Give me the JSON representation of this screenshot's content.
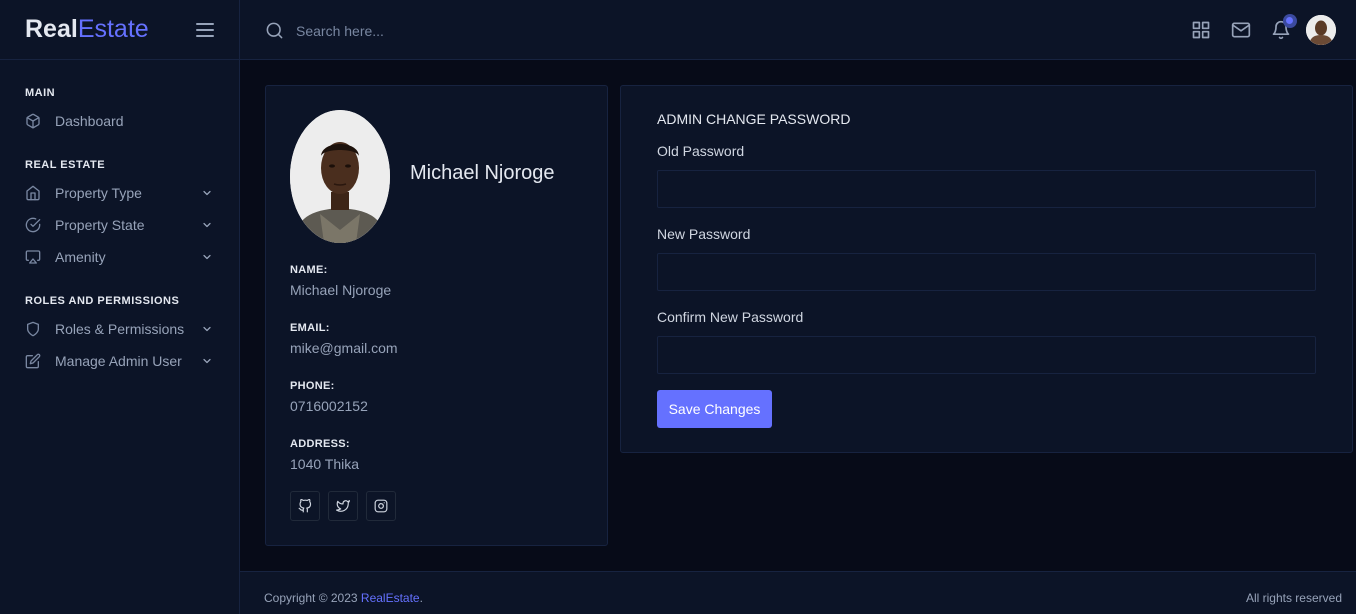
{
  "brand": {
    "part1": "Real",
    "part2": "Estate"
  },
  "search": {
    "placeholder": "Search here..."
  },
  "sidebar": {
    "sections": [
      {
        "label": "MAIN"
      },
      {
        "label": "REAL ESTATE"
      },
      {
        "label": "ROLES AND PERMISSIONS"
      }
    ],
    "items": [
      {
        "label": "Dashboard",
        "icon": "box-icon"
      },
      {
        "label": "Property Type",
        "icon": "home-icon"
      },
      {
        "label": "Property State",
        "icon": "check-circle-icon"
      },
      {
        "label": "Amenity",
        "icon": "airplay-icon"
      },
      {
        "label": "Roles & Permissions",
        "icon": "shield-icon"
      },
      {
        "label": "Manage Admin User",
        "icon": "edit-icon"
      }
    ]
  },
  "profile": {
    "name": "Michael Njoroge",
    "fields": [
      {
        "label": "NAME:",
        "value": "Michael Njoroge"
      },
      {
        "label": "EMAIL:",
        "value": "mike@gmail.com"
      },
      {
        "label": "PHONE:",
        "value": "0716002152"
      },
      {
        "label": "ADDRESS:",
        "value": "1040 Thika"
      }
    ],
    "socials": [
      "github-icon",
      "twitter-icon",
      "instagram-icon"
    ]
  },
  "password_form": {
    "title": "ADMIN CHANGE PASSWORD",
    "old_label": "Old Password",
    "new_label": "New Password",
    "confirm_label": "Confirm New Password",
    "old_value": "",
    "new_value": "",
    "confirm_value": "",
    "save_label": "Save Changes"
  },
  "footer": {
    "copyright_prefix": "Copyright © 2023 ",
    "brand_link": "RealEstate",
    "copyright_suffix": ".",
    "rights": "All rights reserved"
  },
  "colors": {
    "accent": "#6571ff",
    "background": "#070b18",
    "panel": "#0c1427",
    "border": "#172340"
  }
}
